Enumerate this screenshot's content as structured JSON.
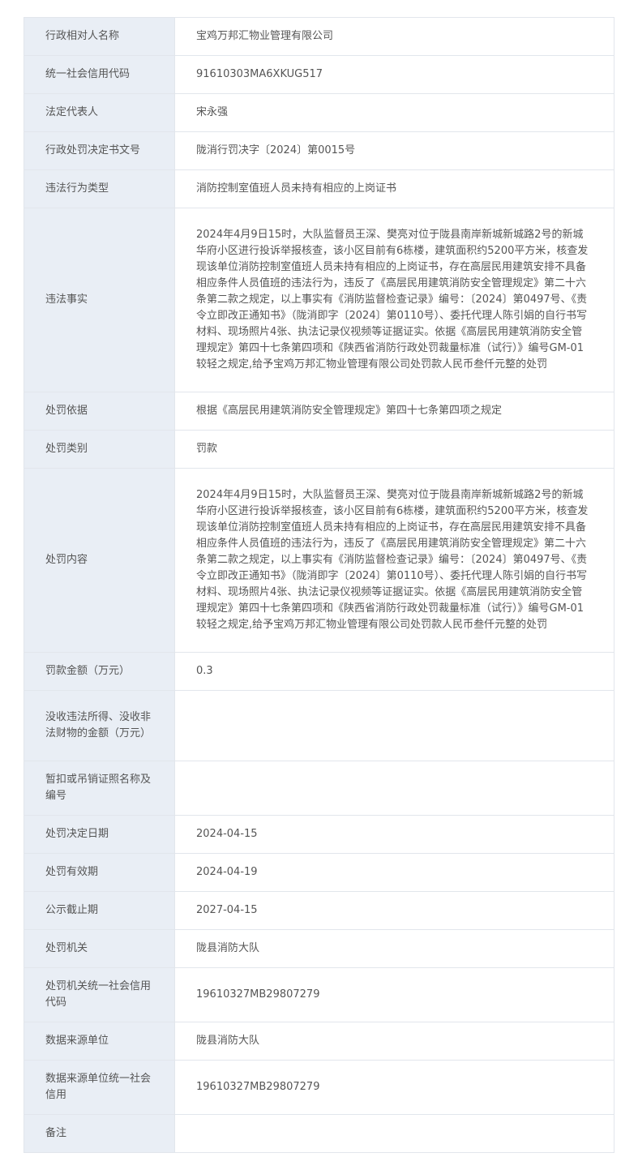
{
  "rows": [
    {
      "label": "行政相对人名称",
      "value": "宝鸡万邦汇物业管理有限公司"
    },
    {
      "label": "统一社会信用代码",
      "value": "91610303MA6XKUG517"
    },
    {
      "label": "法定代表人",
      "value": "宋永强"
    },
    {
      "label": "行政处罚决定书文号",
      "value": "陇消行罚决字〔2024〕第0015号"
    },
    {
      "label": "违法行为类型",
      "value": "消防控制室值班人员未持有相应的上岗证书"
    },
    {
      "label": "违法事实",
      "value": "2024年4月9日15时，大队监督员王深、樊亮对位于陇县南岸新城新城路2号的新城华府小区进行投诉举报核查，该小区目前有6栋楼，建筑面积约5200平方米，核查发现该单位消防控制室值班人员未持有相应的上岗证书，存在高层民用建筑安排不具备相应条件人员值班的违法行为，违反了《高层民用建筑消防安全管理规定》第二十六条第二款之规定，以上事实有《消防监督检查记录》编号：〔2024〕第0497号、《责令立即改正通知书》（陇消即字〔2024〕第0110号）、委托代理人陈引娟的自行书写材料、现场照片4张、执法记录仪视频等证据证实。依据《高层民用建筑消防安全管理规定》第四十七条第四项和《陕西省消防行政处罚裁量标准（试行）》编号GM-01较轻之规定,给予宝鸡万邦汇物业管理有限公司处罚款人民币叁仟元整的处罚"
    },
    {
      "label": "处罚依据",
      "value": "根据《高层民用建筑消防安全管理规定》第四十七条第四项之规定"
    },
    {
      "label": "处罚类别",
      "value": "罚款"
    },
    {
      "label": "处罚内容",
      "value": "2024年4月9日15时，大队监督员王深、樊亮对位于陇县南岸新城新城路2号的新城华府小区进行投诉举报核查，该小区目前有6栋楼，建筑面积约5200平方米，核查发现该单位消防控制室值班人员未持有相应的上岗证书，存在高层民用建筑安排不具备相应条件人员值班的违法行为，违反了《高层民用建筑消防安全管理规定》第二十六条第二款之规定，以上事实有《消防监督检查记录》编号：〔2024〕第0497号、《责令立即改正通知书》（陇消即字〔2024〕第0110号）、委托代理人陈引娟的自行书写材料、现场照片4张、执法记录仪视频等证据证实。依据《高层民用建筑消防安全管理规定》第四十七条第四项和《陕西省消防行政处罚裁量标准（试行）》编号GM-01较轻之规定,给予宝鸡万邦汇物业管理有限公司处罚款人民币叁仟元整的处罚"
    },
    {
      "label": "罚款金额（万元）",
      "value": "0.3"
    },
    {
      "label": "没收违法所得、没收非法财物的金额（万元）",
      "value": ""
    },
    {
      "label": "暂扣或吊销证照名称及编号",
      "value": ""
    },
    {
      "label": "处罚决定日期",
      "value": "2024-04-15"
    },
    {
      "label": "处罚有效期",
      "value": "2024-04-19"
    },
    {
      "label": "公示截止期",
      "value": "2027-04-15"
    },
    {
      "label": "处罚机关",
      "value": "陇县消防大队"
    },
    {
      "label": "处罚机关统一社会信用代码",
      "value": "19610327MB29807279"
    },
    {
      "label": "数据来源单位",
      "value": "陇县消防大队"
    },
    {
      "label": "数据来源单位统一社会信用",
      "value": "19610327MB29807279"
    },
    {
      "label": "备注",
      "value": ""
    }
  ]
}
